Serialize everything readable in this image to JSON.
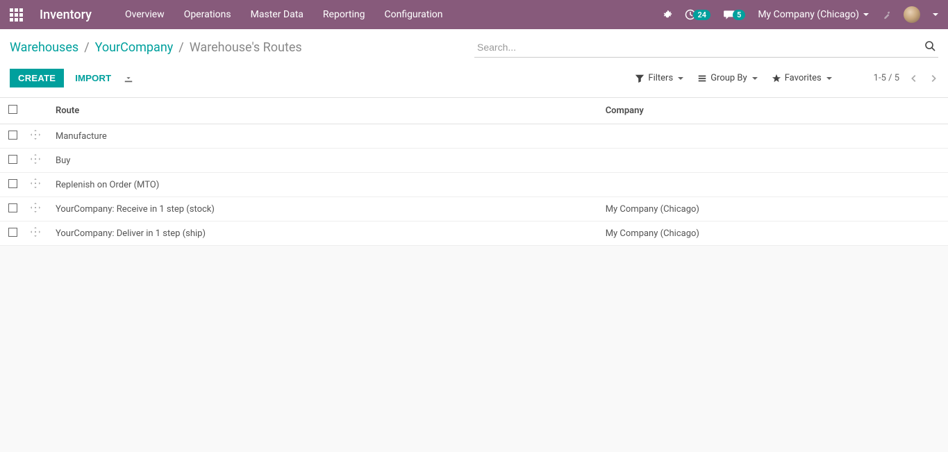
{
  "app_title": "Inventory",
  "nav": [
    "Overview",
    "Operations",
    "Master Data",
    "Reporting",
    "Configuration"
  ],
  "badges": {
    "clock": "24",
    "messages": "5"
  },
  "company_name": "My Company (Chicago)",
  "breadcrumb": {
    "items": [
      "Warehouses",
      "YourCompany"
    ],
    "current": "Warehouse's Routes"
  },
  "search": {
    "placeholder": "Search..."
  },
  "buttons": {
    "create": "CREATE",
    "import": "IMPORT"
  },
  "toolbar": {
    "filters": "Filters",
    "groupby": "Group By",
    "favorites": "Favorites"
  },
  "pager": {
    "range": "1-5 / 5"
  },
  "table": {
    "headers": {
      "route": "Route",
      "company": "Company"
    },
    "rows": [
      {
        "route": "Manufacture",
        "company": ""
      },
      {
        "route": "Buy",
        "company": ""
      },
      {
        "route": "Replenish on Order (MTO)",
        "company": ""
      },
      {
        "route": "YourCompany: Receive in 1 step (stock)",
        "company": "My Company (Chicago)"
      },
      {
        "route": "YourCompany: Deliver in 1 step (ship)",
        "company": "My Company (Chicago)"
      }
    ]
  }
}
